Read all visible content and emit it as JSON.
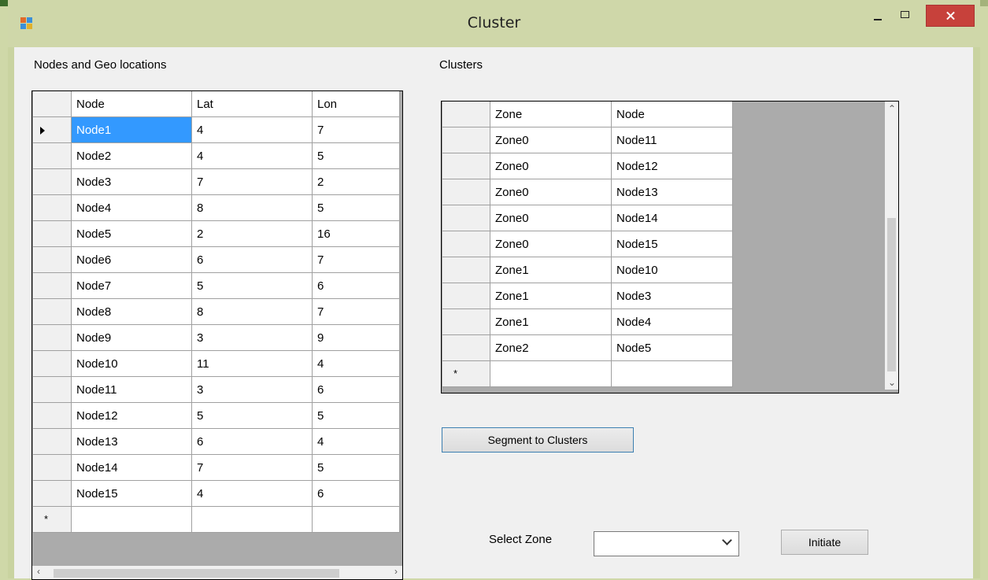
{
  "window": {
    "title": "Cluster"
  },
  "nodes_section": {
    "label": "Nodes and Geo locations",
    "columns": [
      "Node",
      "Lat",
      "Lon"
    ],
    "rows": [
      [
        "Node1",
        "4",
        "7"
      ],
      [
        "Node2",
        "4",
        "5"
      ],
      [
        "Node3",
        "7",
        "2"
      ],
      [
        "Node4",
        "8",
        "5"
      ],
      [
        "Node5",
        "2",
        "16"
      ],
      [
        "Node6",
        "6",
        "7"
      ],
      [
        "Node7",
        "5",
        "6"
      ],
      [
        "Node8",
        "8",
        "7"
      ],
      [
        "Node9",
        "3",
        "9"
      ],
      [
        "Node10",
        "11",
        "4"
      ],
      [
        "Node11",
        "3",
        "6"
      ],
      [
        "Node12",
        "5",
        "5"
      ],
      [
        "Node13",
        "6",
        "4"
      ],
      [
        "Node14",
        "7",
        "5"
      ],
      [
        "Node15",
        "4",
        "6"
      ]
    ],
    "new_row_marker": "*",
    "selected_row": 0
  },
  "clusters_section": {
    "label": "Clusters",
    "columns": [
      "Zone",
      "Node"
    ],
    "rows": [
      [
        "Zone0",
        "Node11"
      ],
      [
        "Zone0",
        "Node12"
      ],
      [
        "Zone0",
        "Node13"
      ],
      [
        "Zone0",
        "Node14"
      ],
      [
        "Zone0",
        "Node15"
      ],
      [
        "Zone1",
        "Node10"
      ],
      [
        "Zone1",
        "Node3"
      ],
      [
        "Zone1",
        "Node4"
      ],
      [
        "Zone2",
        "Node5"
      ]
    ],
    "new_row_marker": "*"
  },
  "segment_button": {
    "label": "Segment to Clusters"
  },
  "zone_select": {
    "label": "Select Zone",
    "value": ""
  },
  "initiate_button": {
    "label": "Initiate"
  },
  "icons": {
    "app": "app-icon",
    "minimize": "minimize-icon",
    "maximize": "maximize-icon",
    "close": "close-icon",
    "row_pointer": "row-pointer-icon",
    "dropdown": "chevron-down-icon"
  },
  "colors": {
    "selection": "#3399ff",
    "close_button": "#c7413b",
    "titlebar": "#cfd7a9",
    "button_border": "#3c7fb1"
  }
}
